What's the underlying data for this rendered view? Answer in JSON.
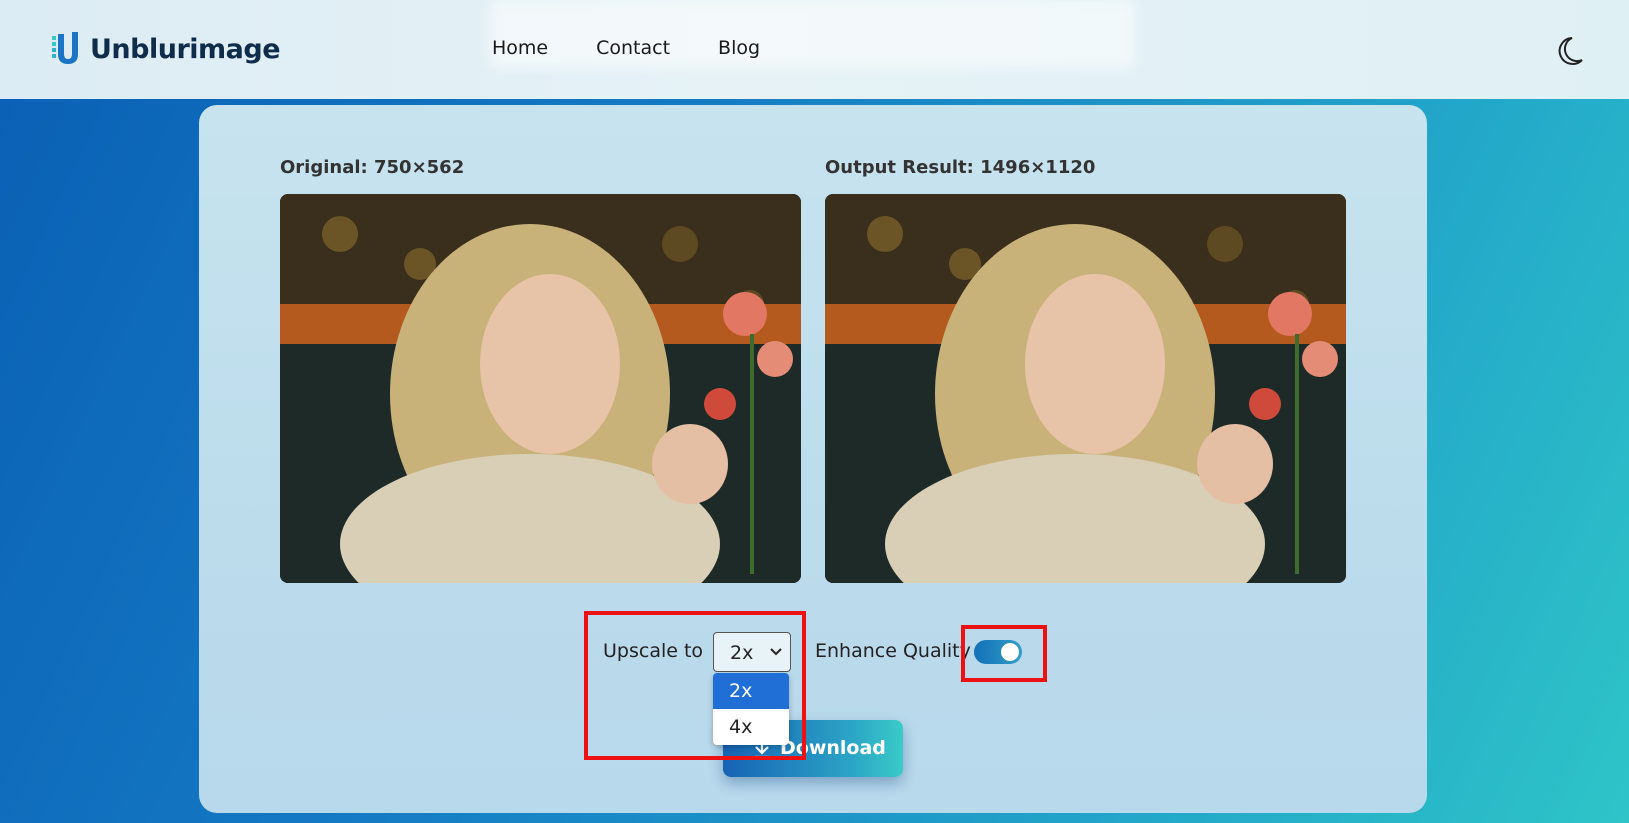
{
  "header": {
    "brand": "Unblurimage",
    "nav": [
      {
        "label": "Home"
      },
      {
        "label": "Contact"
      },
      {
        "label": "Blog"
      }
    ],
    "theme_toggle_icon": "moon-icon"
  },
  "main": {
    "original_label": "Original: 750×562",
    "output_label": "Output Result: 1496×1120",
    "upscale_label": "Upscale to",
    "upscale_selected": "2x",
    "upscale_options": [
      "2x",
      "4x"
    ],
    "enhance_label": "Enhance Quality",
    "enhance_on": true,
    "download_label": "Download",
    "download_icon": "download-icon"
  },
  "colors": {
    "accent": "#1f6fd6",
    "highlight": "#ee1111"
  }
}
